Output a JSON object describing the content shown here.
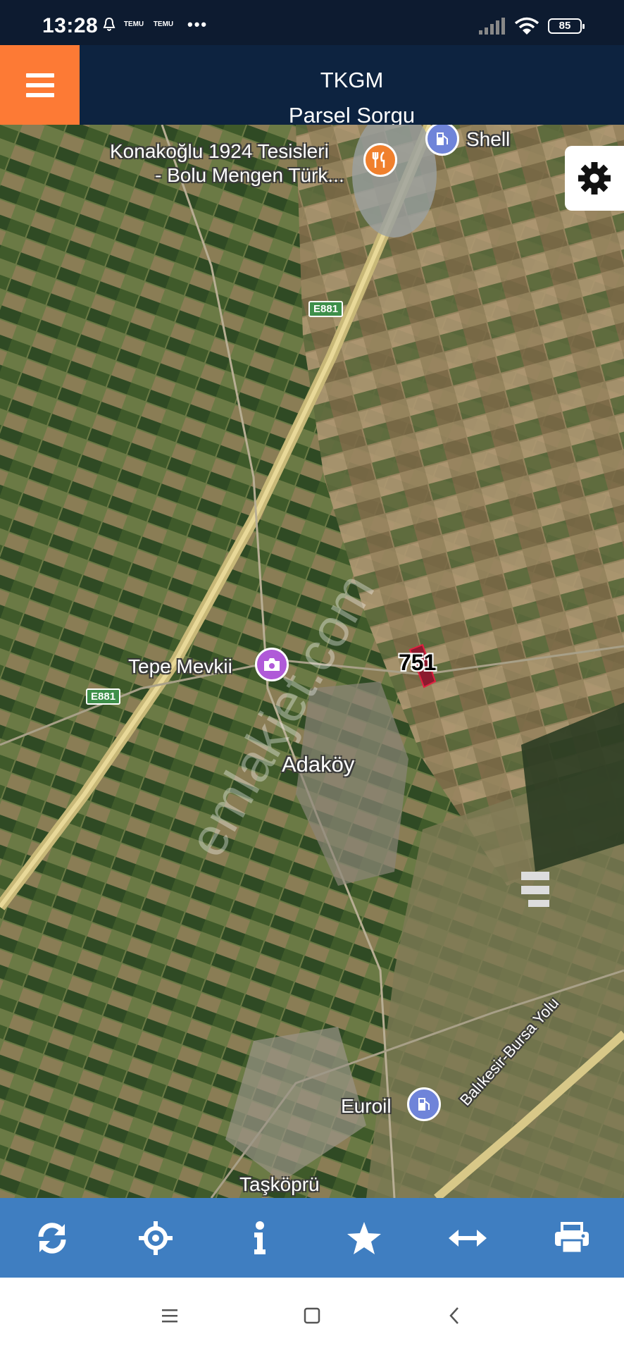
{
  "status_bar": {
    "time": "13:28",
    "notification_labels": [
      "TEMU",
      "TEMU"
    ],
    "battery": "85",
    "icons": [
      "notification-bell-icon",
      "signal-icon",
      "wifi-icon",
      "battery-icon"
    ]
  },
  "app_bar": {
    "title": "TKGM",
    "subtitle": "Parsel Sorgu",
    "menu_icon": "hamburger-menu-icon",
    "accent_color": "#fd7a35",
    "background_color": "#0d2340"
  },
  "map": {
    "places": {
      "konakoglu_line1": "Konakoğlu 1924 Tesisleri",
      "konakoglu_line2": "- Bolu Mengen Türk...",
      "shell": "Shell",
      "tepe_mevkii": "Tepe Mevkii",
      "adakoy": "Adaköy",
      "euroil": "Euroil",
      "taskopru": "Taşköprü",
      "road_name": "Balıkesir-Bursa Yolu"
    },
    "road_shields": [
      "E881",
      "E881"
    ],
    "parcel_number": "751",
    "watermark": "emlakjet.com",
    "settings_icon": "gear-icon"
  },
  "toolbar": {
    "color": "#3f7ec1",
    "buttons": [
      {
        "name": "refresh",
        "icon": "refresh-icon"
      },
      {
        "name": "locate",
        "icon": "crosshair-icon"
      },
      {
        "name": "info",
        "icon": "info-icon"
      },
      {
        "name": "favorite",
        "icon": "star-icon"
      },
      {
        "name": "measure",
        "icon": "arrows-horizontal-icon"
      },
      {
        "name": "print",
        "icon": "printer-icon"
      }
    ]
  },
  "nav_bar": {
    "buttons": [
      "menu-icon",
      "home-icon",
      "back-icon"
    ]
  }
}
